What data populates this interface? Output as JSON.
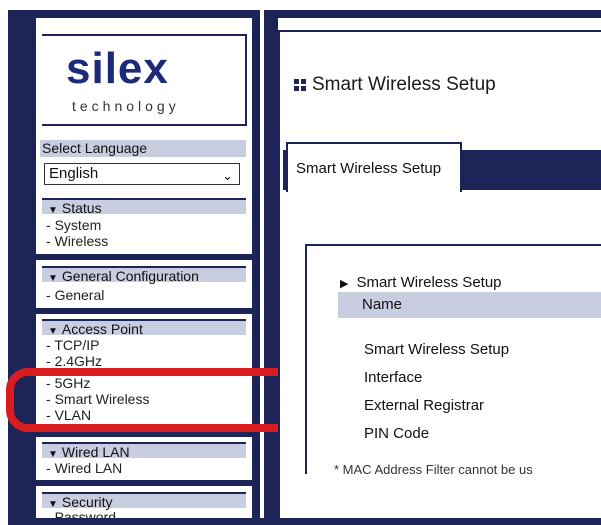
{
  "logo": {
    "brand": "silex",
    "tagline": "technology"
  },
  "language": {
    "title": "Select Language",
    "selected": "English"
  },
  "nav": {
    "status": {
      "label": "Status",
      "items": [
        "System",
        "Wireless"
      ]
    },
    "general": {
      "label": "General Configuration",
      "items": [
        "General"
      ]
    },
    "access_point": {
      "label": "Access Point",
      "items": [
        "TCP/IP",
        "2.4GHz",
        "5GHz",
        "Smart Wireless",
        "VLAN"
      ]
    },
    "wired": {
      "label": "Wired LAN",
      "items": [
        "Wired LAN"
      ]
    },
    "security": {
      "label": "Security",
      "items": [
        "Password"
      ]
    }
  },
  "main": {
    "title": "Smart Wireless Setup",
    "tab": "Smart Wireless Setup",
    "section": "Smart Wireless Setup",
    "name_header": "Name",
    "fields": [
      "Smart Wireless Setup",
      "Interface",
      "External Registrar",
      "PIN Code"
    ],
    "footnote": "* MAC Address Filter cannot be us"
  },
  "colors": {
    "frame": "#1d2457",
    "band": "#c8cde0",
    "highlight": "#d81c20"
  }
}
